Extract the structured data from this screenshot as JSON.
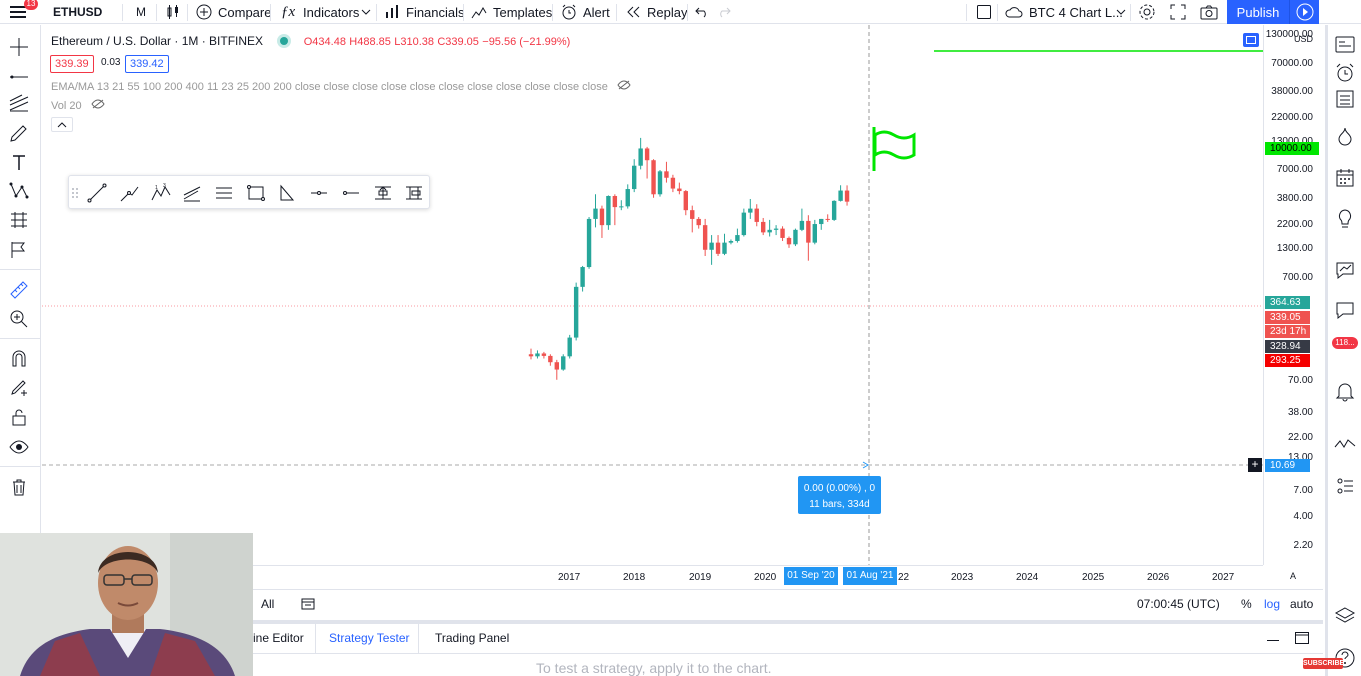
{
  "topbar": {
    "notification_count": "13",
    "symbol": "ETHUSD",
    "interval": "M",
    "compare": "Compare",
    "indicators": "Indicators",
    "financials": "Financials",
    "templates": "Templates",
    "alert": "Alert",
    "replay": "Replay",
    "layout_name": "BTC 4 Chart L...",
    "publish": "Publish"
  },
  "legend": {
    "title": "Ethereum / U.S. Dollar · 1M · BITFINEX",
    "open": "O434.48",
    "high": "H488.85",
    "low": "L310.38",
    "close": "C339.05",
    "change": "−95.56 (−21.99%)",
    "bid": "339.39",
    "spread": "0.03",
    "ask": "339.42",
    "ema_line": "EMA/MA 13 21 55 100 200 400 11 23 25 200 200 close close close close close close close close close close close",
    "vol_line": "Vol 20"
  },
  "price_axis": {
    "currency": "USD",
    "ticks": [
      "130000.00",
      "70000.00",
      "38000.00",
      "22000.00",
      "13000.00",
      "7000.00",
      "3800.00",
      "2200.00",
      "1300.00",
      "700.00",
      "70.00",
      "38.00",
      "22.00",
      "13.00",
      "7.00",
      "4.00",
      "2.20"
    ],
    "tag_flag_level": "10000.00",
    "tag_high": "364.63",
    "tag_close": "339.05",
    "tag_countdown": "23d 17h",
    "tag_mid": "328.94",
    "tag_low": "293.25",
    "tag_cursor": "10.69"
  },
  "time_axis": {
    "labels": [
      "2017",
      "2018",
      "2019",
      "2020",
      "22",
      "2023",
      "2024",
      "2025",
      "2026",
      "2027"
    ],
    "range_start": "01 Sep '20",
    "range_end": "01 Aug '21",
    "auto_scale": "A"
  },
  "measure": {
    "line1": "0.00 (0.00%) , 0",
    "line2": "11 bars, 334d"
  },
  "bottombar": {
    "range_all": "All",
    "clock": "07:00:45 (UTC)",
    "percent": "%",
    "log": "log",
    "auto": "auto"
  },
  "tabs": [
    "ine Editor",
    "Strategy Tester",
    "Trading Panel"
  ],
  "strategy_hint": "To test a strategy, apply it to the chart.",
  "right_badge": "118...",
  "subscribe": "SUBSCRIBE",
  "colors": {
    "up": "#26a69a",
    "down": "#ef5350",
    "accent": "#2962ff",
    "flag": "#00e600"
  },
  "chart_data": {
    "type": "candlestick",
    "symbol": "ETHUSD",
    "scale": "log",
    "candles": [
      {
        "t": "2016-08",
        "o": 11,
        "h": 12.5,
        "l": 9.8,
        "c": 10.5
      },
      {
        "t": "2016-09",
        "o": 10.5,
        "h": 12,
        "l": 10,
        "c": 11.2
      },
      {
        "t": "2016-10",
        "o": 11.2,
        "h": 11.6,
        "l": 10,
        "c": 10.6
      },
      {
        "t": "2016-11",
        "o": 10.6,
        "h": 11,
        "l": 8.5,
        "c": 9.2
      },
      {
        "t": "2016-12",
        "o": 9.2,
        "h": 9.7,
        "l": 6.2,
        "c": 7.8
      },
      {
        "t": "2017-01",
        "o": 7.8,
        "h": 11,
        "l": 7.6,
        "c": 10.5
      },
      {
        "t": "2017-02",
        "o": 10.5,
        "h": 17,
        "l": 10,
        "c": 16
      },
      {
        "t": "2017-03",
        "o": 16,
        "h": 55,
        "l": 15,
        "c": 50
      },
      {
        "t": "2017-04",
        "o": 50,
        "h": 80,
        "l": 45,
        "c": 78
      },
      {
        "t": "2017-05",
        "o": 78,
        "h": 240,
        "l": 75,
        "c": 230
      },
      {
        "t": "2017-06",
        "o": 230,
        "h": 400,
        "l": 190,
        "c": 290
      },
      {
        "t": "2017-07",
        "o": 290,
        "h": 310,
        "l": 150,
        "c": 200
      },
      {
        "t": "2017-08",
        "o": 200,
        "h": 390,
        "l": 180,
        "c": 385
      },
      {
        "t": "2017-09",
        "o": 385,
        "h": 400,
        "l": 200,
        "c": 300
      },
      {
        "t": "2017-10",
        "o": 300,
        "h": 350,
        "l": 280,
        "c": 305
      },
      {
        "t": "2017-11",
        "o": 305,
        "h": 500,
        "l": 290,
        "c": 450
      },
      {
        "t": "2017-12",
        "o": 450,
        "h": 880,
        "l": 420,
        "c": 760
      },
      {
        "t": "2018-01",
        "o": 760,
        "h": 1420,
        "l": 700,
        "c": 1120
      },
      {
        "t": "2018-02",
        "o": 1120,
        "h": 1160,
        "l": 570,
        "c": 860
      },
      {
        "t": "2018-03",
        "o": 860,
        "h": 880,
        "l": 370,
        "c": 400
      },
      {
        "t": "2018-04",
        "o": 400,
        "h": 690,
        "l": 380,
        "c": 670
      },
      {
        "t": "2018-05",
        "o": 670,
        "h": 830,
        "l": 520,
        "c": 580
      },
      {
        "t": "2018-06",
        "o": 580,
        "h": 620,
        "l": 420,
        "c": 455
      },
      {
        "t": "2018-07",
        "o": 455,
        "h": 520,
        "l": 400,
        "c": 430
      },
      {
        "t": "2018-08",
        "o": 430,
        "h": 440,
        "l": 250,
        "c": 280
      },
      {
        "t": "2018-09",
        "o": 280,
        "h": 310,
        "l": 170,
        "c": 230
      },
      {
        "t": "2018-10",
        "o": 230,
        "h": 240,
        "l": 185,
        "c": 200
      },
      {
        "t": "2018-11",
        "o": 200,
        "h": 230,
        "l": 100,
        "c": 115
      },
      {
        "t": "2018-12",
        "o": 115,
        "h": 160,
        "l": 82,
        "c": 135
      },
      {
        "t": "2019-01",
        "o": 135,
        "h": 160,
        "l": 100,
        "c": 105
      },
      {
        "t": "2019-02",
        "o": 105,
        "h": 165,
        "l": 102,
        "c": 135
      },
      {
        "t": "2019-03",
        "o": 135,
        "h": 145,
        "l": 130,
        "c": 140
      },
      {
        "t": "2019-04",
        "o": 140,
        "h": 185,
        "l": 135,
        "c": 160
      },
      {
        "t": "2019-05",
        "o": 160,
        "h": 290,
        "l": 155,
        "c": 265
      },
      {
        "t": "2019-06",
        "o": 265,
        "h": 360,
        "l": 230,
        "c": 290
      },
      {
        "t": "2019-07",
        "o": 290,
        "h": 320,
        "l": 195,
        "c": 215
      },
      {
        "t": "2019-08",
        "o": 215,
        "h": 235,
        "l": 160,
        "c": 170
      },
      {
        "t": "2019-09",
        "o": 170,
        "h": 225,
        "l": 155,
        "c": 180
      },
      {
        "t": "2019-10",
        "o": 180,
        "h": 200,
        "l": 160,
        "c": 185
      },
      {
        "t": "2019-11",
        "o": 185,
        "h": 195,
        "l": 140,
        "c": 150
      },
      {
        "t": "2019-12",
        "o": 150,
        "h": 155,
        "l": 120,
        "c": 130
      },
      {
        "t": "2020-01",
        "o": 130,
        "h": 185,
        "l": 125,
        "c": 180
      },
      {
        "t": "2020-02",
        "o": 180,
        "h": 290,
        "l": 175,
        "c": 220
      },
      {
        "t": "2020-03",
        "o": 220,
        "h": 250,
        "l": 90,
        "c": 135
      },
      {
        "t": "2020-04",
        "o": 135,
        "h": 225,
        "l": 130,
        "c": 205
      },
      {
        "t": "2020-05",
        "o": 205,
        "h": 230,
        "l": 180,
        "c": 230
      },
      {
        "t": "2020-06",
        "o": 230,
        "h": 255,
        "l": 215,
        "c": 225
      },
      {
        "t": "2020-07",
        "o": 225,
        "h": 350,
        "l": 220,
        "c": 345
      },
      {
        "t": "2020-08",
        "o": 345,
        "h": 490,
        "l": 340,
        "c": 435
      },
      {
        "t": "2020-09",
        "o": 435,
        "h": 489,
        "l": 310,
        "c": 339
      }
    ],
    "flag_level": 10000
  }
}
